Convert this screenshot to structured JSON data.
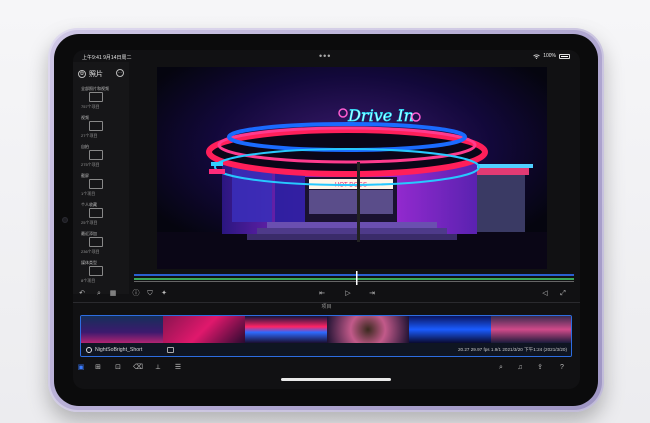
{
  "status_bar": {
    "time": "上午9:41  9月14日周二",
    "dots": "•••",
    "battery": "100%"
  },
  "sidebar": {
    "title": "照片",
    "items": [
      {
        "label": "全部照片和视频",
        "count": "757个项目",
        "icon": "folder-icon"
      },
      {
        "label": "视频",
        "count": "27个项目",
        "icon": "video-icon"
      },
      {
        "label": "自拍",
        "count": "275个项目",
        "icon": "camera-icon"
      },
      {
        "label": "截屏",
        "count": "1个项目",
        "icon": "screenshot-icon"
      },
      {
        "label": "个人收藏",
        "count": "25个项目",
        "icon": "heart-icon"
      },
      {
        "label": "最近添加",
        "count": "236个项目",
        "icon": "folder-icon"
      },
      {
        "label": "媒体类型",
        "count": "8个项目",
        "icon": "folder-icon"
      }
    ]
  },
  "viewer": {
    "sign_text": "Drive In",
    "booth_text": "HOT DOGS"
  },
  "project": {
    "label": "项目"
  },
  "clip": {
    "name": "NightSoBright_Short",
    "meta": "20.27   29.97 fps   1.9/1   2021/3/20   下午1:24   (2021/3/20)"
  },
  "colors": {
    "clip_border": "#2d6de1",
    "accent": "#3a7bff",
    "ipad_shell": "#b7aed6"
  }
}
